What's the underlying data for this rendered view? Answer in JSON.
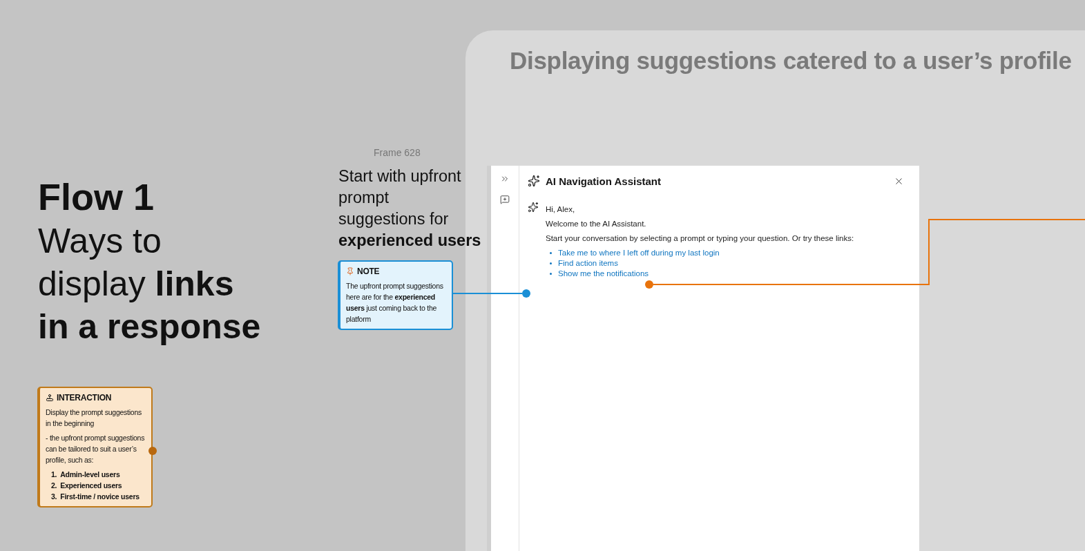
{
  "section": {
    "title": "Displaying suggestions catered to a user’s profile"
  },
  "flow": {
    "label": "Flow 1",
    "lines": [
      "Ways to",
      "display **links**",
      "**in a response**"
    ]
  },
  "interaction": {
    "title": "INTERACTION",
    "paragraphs": [
      "Display the prompt suggestions in the beginning",
      "- the upfront prompt suggestions can be tailored to suit a user’s profile, such as:"
    ],
    "items": [
      {
        "number": "1.",
        "text": "Admin-level users"
      },
      {
        "number": "2.",
        "text": "Experienced users"
      },
      {
        "number": "3.",
        "text": "First-time / novice users"
      }
    ]
  },
  "frame": {
    "label": "Frame 628",
    "lines": [
      "Start with upfront",
      "prompt",
      "suggestions for",
      "**experienced users**"
    ]
  },
  "note": {
    "title": "NOTE",
    "text": "The upfront prompt suggestions here are for the **experienced users** just coming back to the platform"
  },
  "assistant": {
    "title": "AI Navigation Assistant",
    "messages": [
      "Hi, Alex,",
      "Welcome to the AI Assistant.",
      "Start your conversation by selecting a prompt or typing your question. Or try these links:"
    ],
    "links": [
      "Take me to where I left off during my last login",
      "Find action items",
      "Show me the notifications"
    ]
  }
}
